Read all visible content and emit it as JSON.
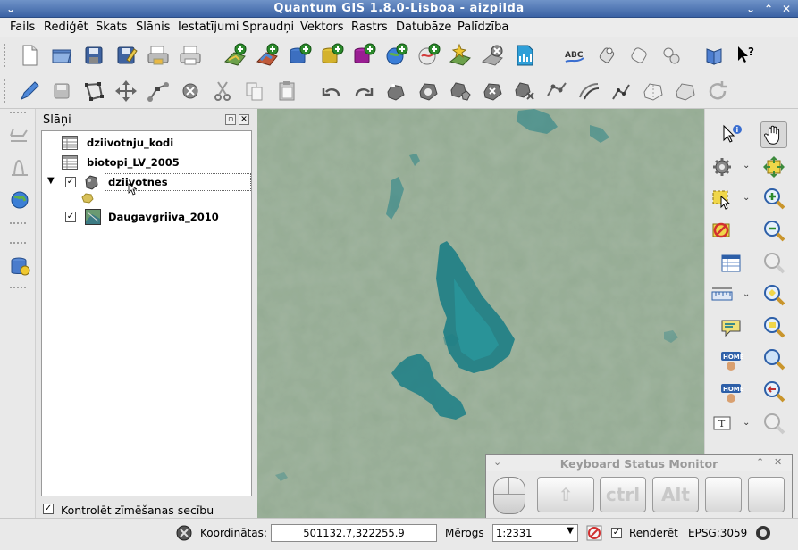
{
  "window": {
    "title": "Quantum GIS 1.8.0-Lisboa - aizpilda"
  },
  "menu": [
    "Fails",
    "Rediģēt",
    "Skats",
    "Slānis",
    "Iestatījumi",
    "Spraudņi",
    "Vektors",
    "Rastrs",
    "Datubāze",
    "Palīdzība"
  ],
  "layers_panel": {
    "title": "Slāņi",
    "layers": [
      {
        "name": "dziivotnju_kodi",
        "type": "table",
        "checked": null
      },
      {
        "name": "biotopi_LV_2005",
        "type": "table",
        "checked": null
      },
      {
        "name": "dziivotnes",
        "type": "polygon",
        "checked": true,
        "expanded": true,
        "editing": true
      },
      {
        "name": "Daugavgriiva_2010",
        "type": "raster",
        "checked": true
      }
    ],
    "render_order_label": "Kontrolēt zīmēšanas secību",
    "render_order_checked": true
  },
  "keyboard_monitor": {
    "title": "Keyboard Status Monitor",
    "keys": [
      "⇧",
      "ctrl",
      "Alt",
      "",
      ""
    ]
  },
  "status": {
    "coord_label": "Koordinātas:",
    "coord_value": "501132.7,322255.9",
    "scale_label": "Mērogs",
    "scale_value": "1:2331",
    "render_label": "Renderēt",
    "render_checked": true,
    "crs": "EPSG:3059"
  },
  "colors": {
    "titlebar": "#4a70b0",
    "water": "#1f7f86",
    "land": "#8ea893"
  }
}
